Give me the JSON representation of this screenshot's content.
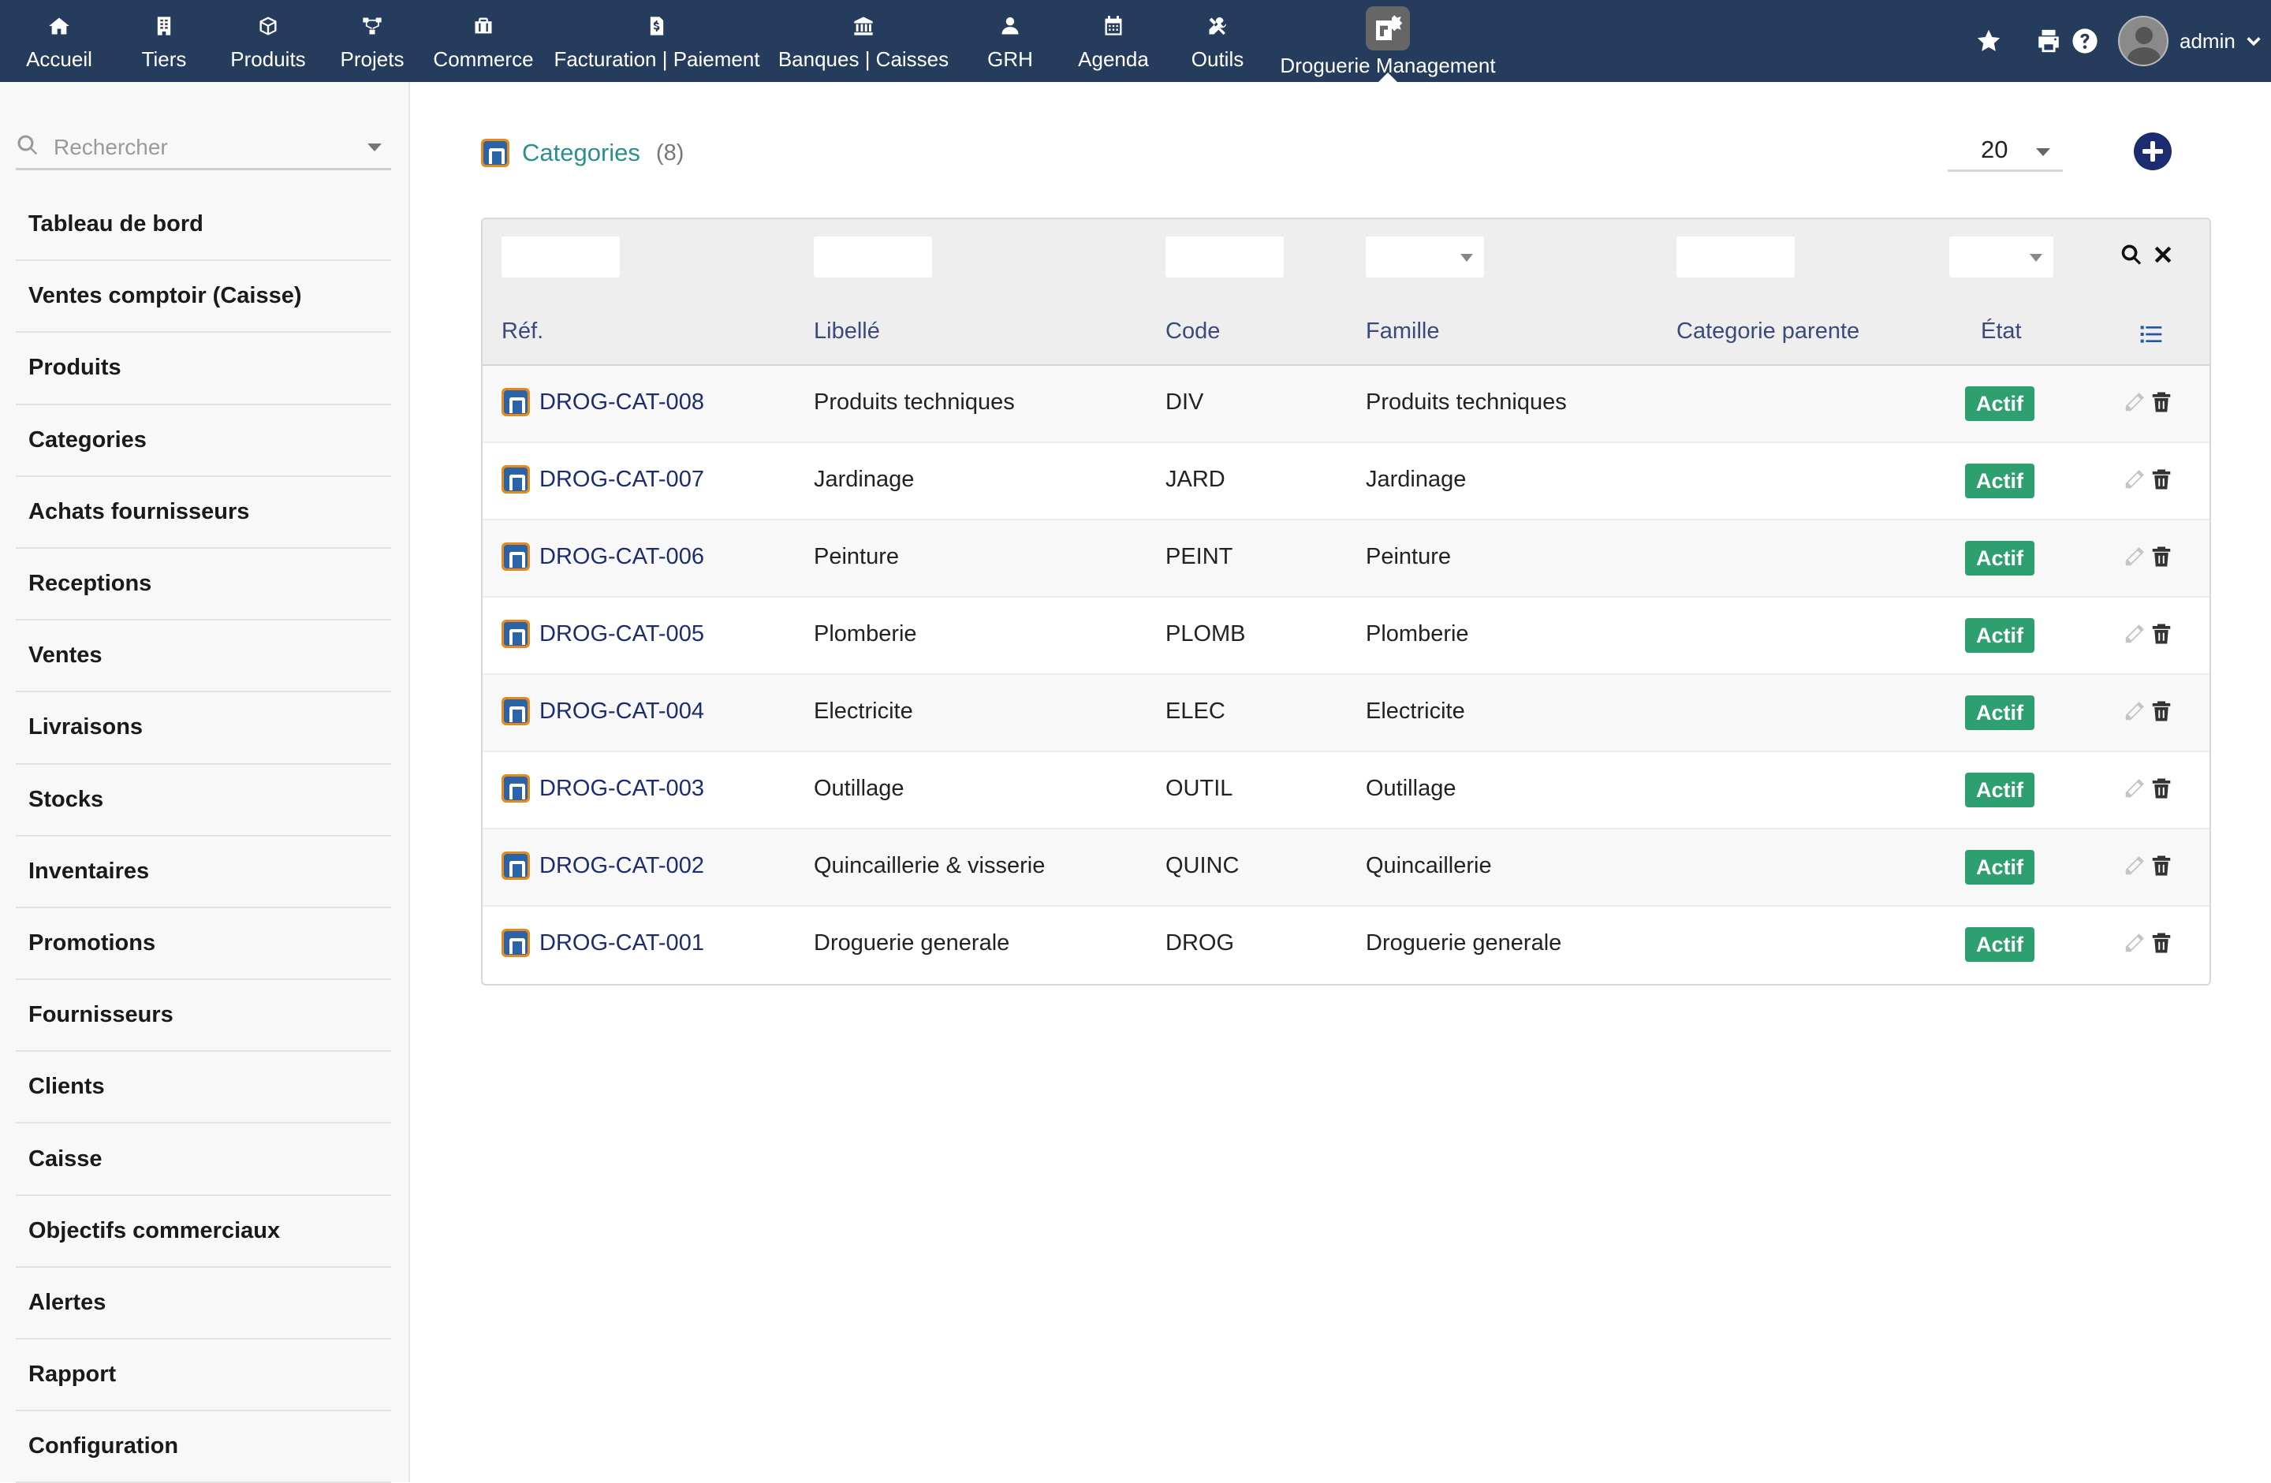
{
  "topnav": {
    "items": [
      {
        "label": "Accueil",
        "icon": "home-icon"
      },
      {
        "label": "Tiers",
        "icon": "building-icon"
      },
      {
        "label": "Produits",
        "icon": "cube-icon"
      },
      {
        "label": "Projets",
        "icon": "project-icon"
      },
      {
        "label": "Commerce",
        "icon": "briefcase-icon"
      },
      {
        "label": "Facturation | Paiement",
        "icon": "invoice-icon"
      },
      {
        "label": "Banques | Caisses",
        "icon": "bank-icon"
      },
      {
        "label": "GRH",
        "icon": "user-icon"
      },
      {
        "label": "Agenda",
        "icon": "calendar-icon"
      },
      {
        "label": "Outils",
        "icon": "tools-icon"
      },
      {
        "label": "Droguerie Management",
        "icon": "droguerie-module-icon",
        "active": true
      }
    ],
    "user": {
      "name": "admin"
    }
  },
  "sidebar": {
    "search_placeholder": "Rechercher",
    "items": [
      {
        "label": "Tableau de bord"
      },
      {
        "label": "Ventes comptoir (Caisse)"
      },
      {
        "label": "Produits"
      },
      {
        "label": "Categories"
      },
      {
        "label": "Achats fournisseurs"
      },
      {
        "label": "Receptions"
      },
      {
        "label": "Ventes"
      },
      {
        "label": "Livraisons"
      },
      {
        "label": "Stocks"
      },
      {
        "label": "Inventaires"
      },
      {
        "label": "Promotions"
      },
      {
        "label": "Fournisseurs"
      },
      {
        "label": "Clients"
      },
      {
        "label": "Caisse"
      },
      {
        "label": "Objectifs commerciaux"
      },
      {
        "label": "Alertes"
      },
      {
        "label": "Rapport"
      },
      {
        "label": "Configuration"
      }
    ]
  },
  "main": {
    "title": "Categories",
    "count": "(8)",
    "page_size": "20",
    "table": {
      "columns": {
        "ref": "Réf.",
        "label": "Libellé",
        "code": "Code",
        "family": "Famille",
        "parent": "Categorie parente",
        "status": "État"
      },
      "rows": [
        {
          "ref": "DROG-CAT-008",
          "label": "Produits techniques",
          "code": "DIV",
          "family": "Produits techniques",
          "parent": "",
          "status": "Actif"
        },
        {
          "ref": "DROG-CAT-007",
          "label": "Jardinage",
          "code": "JARD",
          "family": "Jardinage",
          "parent": "",
          "status": "Actif"
        },
        {
          "ref": "DROG-CAT-006",
          "label": "Peinture",
          "code": "PEINT",
          "family": "Peinture",
          "parent": "",
          "status": "Actif"
        },
        {
          "ref": "DROG-CAT-005",
          "label": "Plomberie",
          "code": "PLOMB",
          "family": "Plomberie",
          "parent": "",
          "status": "Actif"
        },
        {
          "ref": "DROG-CAT-004",
          "label": "Electricite",
          "code": "ELEC",
          "family": "Electricite",
          "parent": "",
          "status": "Actif"
        },
        {
          "ref": "DROG-CAT-003",
          "label": "Outillage",
          "code": "OUTIL",
          "family": "Outillage",
          "parent": "",
          "status": "Actif"
        },
        {
          "ref": "DROG-CAT-002",
          "label": "Quincaillerie & visserie",
          "code": "QUINC",
          "family": "Quincaillerie",
          "parent": "",
          "status": "Actif"
        },
        {
          "ref": "DROG-CAT-001",
          "label": "Droguerie generale",
          "code": "DROG",
          "family": "Droguerie generale",
          "parent": "",
          "status": "Actif"
        }
      ]
    }
  },
  "colors": {
    "topbar": "#263c5c",
    "title_teal": "#2b8f8f",
    "link_navy": "#1b2d6e",
    "badge_green": "#2e9f6f"
  }
}
